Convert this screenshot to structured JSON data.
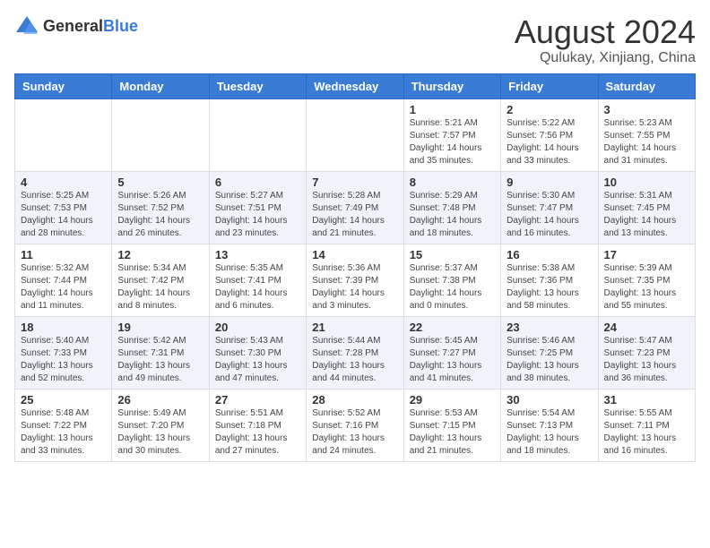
{
  "logo": {
    "general": "General",
    "blue": "Blue"
  },
  "title": {
    "month_year": "August 2024",
    "location": "Qulukay, Xinjiang, China"
  },
  "days_of_week": [
    "Sunday",
    "Monday",
    "Tuesday",
    "Wednesday",
    "Thursday",
    "Friday",
    "Saturday"
  ],
  "weeks": [
    [
      {
        "day": "",
        "info": ""
      },
      {
        "day": "",
        "info": ""
      },
      {
        "day": "",
        "info": ""
      },
      {
        "day": "",
        "info": ""
      },
      {
        "day": "1",
        "info": "Sunrise: 5:21 AM\nSunset: 7:57 PM\nDaylight: 14 hours\nand 35 minutes."
      },
      {
        "day": "2",
        "info": "Sunrise: 5:22 AM\nSunset: 7:56 PM\nDaylight: 14 hours\nand 33 minutes."
      },
      {
        "day": "3",
        "info": "Sunrise: 5:23 AM\nSunset: 7:55 PM\nDaylight: 14 hours\nand 31 minutes."
      }
    ],
    [
      {
        "day": "4",
        "info": "Sunrise: 5:25 AM\nSunset: 7:53 PM\nDaylight: 14 hours\nand 28 minutes."
      },
      {
        "day": "5",
        "info": "Sunrise: 5:26 AM\nSunset: 7:52 PM\nDaylight: 14 hours\nand 26 minutes."
      },
      {
        "day": "6",
        "info": "Sunrise: 5:27 AM\nSunset: 7:51 PM\nDaylight: 14 hours\nand 23 minutes."
      },
      {
        "day": "7",
        "info": "Sunrise: 5:28 AM\nSunset: 7:49 PM\nDaylight: 14 hours\nand 21 minutes."
      },
      {
        "day": "8",
        "info": "Sunrise: 5:29 AM\nSunset: 7:48 PM\nDaylight: 14 hours\nand 18 minutes."
      },
      {
        "day": "9",
        "info": "Sunrise: 5:30 AM\nSunset: 7:47 PM\nDaylight: 14 hours\nand 16 minutes."
      },
      {
        "day": "10",
        "info": "Sunrise: 5:31 AM\nSunset: 7:45 PM\nDaylight: 14 hours\nand 13 minutes."
      }
    ],
    [
      {
        "day": "11",
        "info": "Sunrise: 5:32 AM\nSunset: 7:44 PM\nDaylight: 14 hours\nand 11 minutes."
      },
      {
        "day": "12",
        "info": "Sunrise: 5:34 AM\nSunset: 7:42 PM\nDaylight: 14 hours\nand 8 minutes."
      },
      {
        "day": "13",
        "info": "Sunrise: 5:35 AM\nSunset: 7:41 PM\nDaylight: 14 hours\nand 6 minutes."
      },
      {
        "day": "14",
        "info": "Sunrise: 5:36 AM\nSunset: 7:39 PM\nDaylight: 14 hours\nand 3 minutes."
      },
      {
        "day": "15",
        "info": "Sunrise: 5:37 AM\nSunset: 7:38 PM\nDaylight: 14 hours\nand 0 minutes."
      },
      {
        "day": "16",
        "info": "Sunrise: 5:38 AM\nSunset: 7:36 PM\nDaylight: 13 hours\nand 58 minutes."
      },
      {
        "day": "17",
        "info": "Sunrise: 5:39 AM\nSunset: 7:35 PM\nDaylight: 13 hours\nand 55 minutes."
      }
    ],
    [
      {
        "day": "18",
        "info": "Sunrise: 5:40 AM\nSunset: 7:33 PM\nDaylight: 13 hours\nand 52 minutes."
      },
      {
        "day": "19",
        "info": "Sunrise: 5:42 AM\nSunset: 7:31 PM\nDaylight: 13 hours\nand 49 minutes."
      },
      {
        "day": "20",
        "info": "Sunrise: 5:43 AM\nSunset: 7:30 PM\nDaylight: 13 hours\nand 47 minutes."
      },
      {
        "day": "21",
        "info": "Sunrise: 5:44 AM\nSunset: 7:28 PM\nDaylight: 13 hours\nand 44 minutes."
      },
      {
        "day": "22",
        "info": "Sunrise: 5:45 AM\nSunset: 7:27 PM\nDaylight: 13 hours\nand 41 minutes."
      },
      {
        "day": "23",
        "info": "Sunrise: 5:46 AM\nSunset: 7:25 PM\nDaylight: 13 hours\nand 38 minutes."
      },
      {
        "day": "24",
        "info": "Sunrise: 5:47 AM\nSunset: 7:23 PM\nDaylight: 13 hours\nand 36 minutes."
      }
    ],
    [
      {
        "day": "25",
        "info": "Sunrise: 5:48 AM\nSunset: 7:22 PM\nDaylight: 13 hours\nand 33 minutes."
      },
      {
        "day": "26",
        "info": "Sunrise: 5:49 AM\nSunset: 7:20 PM\nDaylight: 13 hours\nand 30 minutes."
      },
      {
        "day": "27",
        "info": "Sunrise: 5:51 AM\nSunset: 7:18 PM\nDaylight: 13 hours\nand 27 minutes."
      },
      {
        "day": "28",
        "info": "Sunrise: 5:52 AM\nSunset: 7:16 PM\nDaylight: 13 hours\nand 24 minutes."
      },
      {
        "day": "29",
        "info": "Sunrise: 5:53 AM\nSunset: 7:15 PM\nDaylight: 13 hours\nand 21 minutes."
      },
      {
        "day": "30",
        "info": "Sunrise: 5:54 AM\nSunset: 7:13 PM\nDaylight: 13 hours\nand 18 minutes."
      },
      {
        "day": "31",
        "info": "Sunrise: 5:55 AM\nSunset: 7:11 PM\nDaylight: 13 hours\nand 16 minutes."
      }
    ]
  ]
}
